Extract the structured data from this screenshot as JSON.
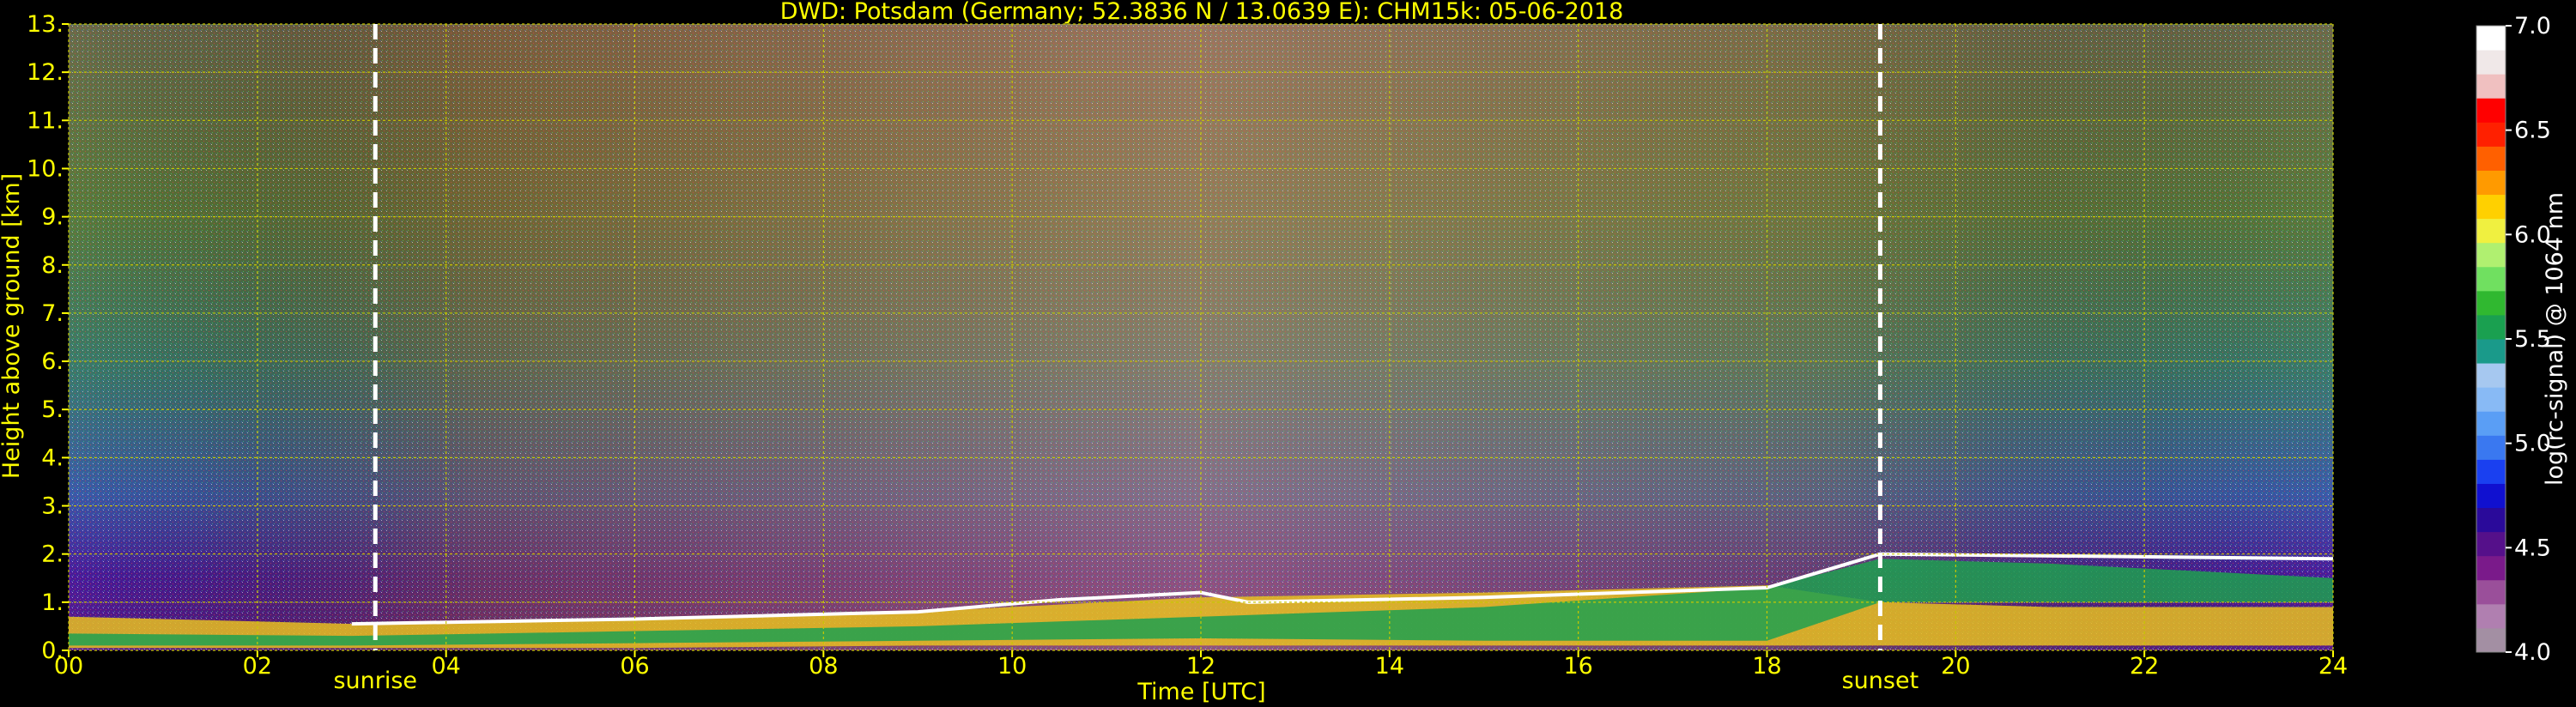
{
  "chart_data": {
    "type": "heatmap",
    "title": "DWD: Potsdam (Germany; 52.3836 N / 13.0639 E):    CHM15k: 05-06-2018",
    "xlabel": "Time [UTC]",
    "ylabel": "Height above ground [km]",
    "xlim": [
      0,
      24
    ],
    "ylim": [
      0,
      13
    ],
    "xticks": [
      0,
      2,
      4,
      6,
      8,
      10,
      12,
      14,
      16,
      18,
      20,
      22,
      24
    ],
    "xtick_labels": [
      "00",
      "02",
      "04",
      "06",
      "08",
      "10",
      "12",
      "14",
      "16",
      "18",
      "20",
      "22",
      "24"
    ],
    "yticks": [
      0,
      1,
      2,
      3,
      4,
      5,
      6,
      7,
      8,
      9,
      10,
      11,
      12,
      13
    ],
    "ytick_labels": [
      "0.",
      "1.",
      "2.",
      "3.",
      "4.",
      "5.",
      "6.",
      "7.",
      "8.",
      "9.",
      "10.",
      "11.",
      "12.",
      "13."
    ],
    "grid": true,
    "markers": [
      {
        "label": "sunrise",
        "x": 3.25
      },
      {
        "label": "sunset",
        "x": 19.2
      }
    ],
    "colorbar": {
      "label": "log(rc-signal) @ 1064 nm",
      "range": [
        4.0,
        7.0
      ],
      "ticks": [
        4.0,
        4.5,
        5.0,
        5.5,
        6.0,
        6.5,
        7.0
      ],
      "tick_labels": [
        "4.0",
        "4.5",
        "5.0",
        "5.5",
        "6.0",
        "6.5",
        "7.0"
      ],
      "colors": [
        "#a38fa3",
        "#b07fb0",
        "#9a4f9a",
        "#7a1a8a",
        "#55108a",
        "#2a0a9a",
        "#1010d0",
        "#1a40f0",
        "#3a78f0",
        "#5a9ef5",
        "#88baf5",
        "#a6c8f0",
        "#1a9a8a",
        "#1aa050",
        "#30b830",
        "#70e060",
        "#b0f070",
        "#f0f040",
        "#ffd000",
        "#ff9a00",
        "#ff6000",
        "#ff2000",
        "#ff0000",
        "#f0c0c0",
        "#f0e8e8",
        "#ffffff"
      ]
    },
    "layers": [
      {
        "x": [
          0,
          3,
          6,
          9,
          12,
          15,
          18,
          19.2,
          21,
          24
        ],
        "base": [
          0.05,
          0.05,
          0.05,
          0.1,
          0.1,
          0.1,
          0.1,
          0.1,
          0.1,
          0.1
        ],
        "top": [
          0.7,
          0.55,
          0.65,
          0.8,
          1.1,
          1.2,
          1.35,
          1.0,
          0.9,
          0.9
        ],
        "color": "#e8c020"
      },
      {
        "x": [
          0,
          3,
          6,
          9,
          12,
          15,
          18,
          19.2,
          21,
          24
        ],
        "base": [
          0.1,
          0.1,
          0.15,
          0.2,
          0.25,
          0.2,
          0.2,
          1.0,
          1.0,
          1.0
        ],
        "top": [
          0.35,
          0.3,
          0.4,
          0.5,
          0.7,
          0.9,
          1.3,
          1.9,
          1.8,
          1.5
        ],
        "color": "#1ea050"
      }
    ],
    "boundary_line": {
      "x": [
        3,
        6,
        9,
        10.5,
        12,
        12.5,
        15,
        18,
        19.2,
        24
      ],
      "y": [
        0.55,
        0.65,
        0.8,
        1.05,
        1.2,
        1.0,
        1.1,
        1.3,
        2.0,
        1.9
      ]
    },
    "density": [
      {
        "x": [
          0,
          6,
          12,
          18,
          24
        ],
        "y": [
          13,
          13,
          13,
          13,
          13
        ]
      },
      {
        "x": [
          0,
          6,
          12,
          18,
          24
        ],
        "y": [
          2.0,
          2.0,
          2.0,
          2.0,
          2.0
        ]
      }
    ]
  }
}
